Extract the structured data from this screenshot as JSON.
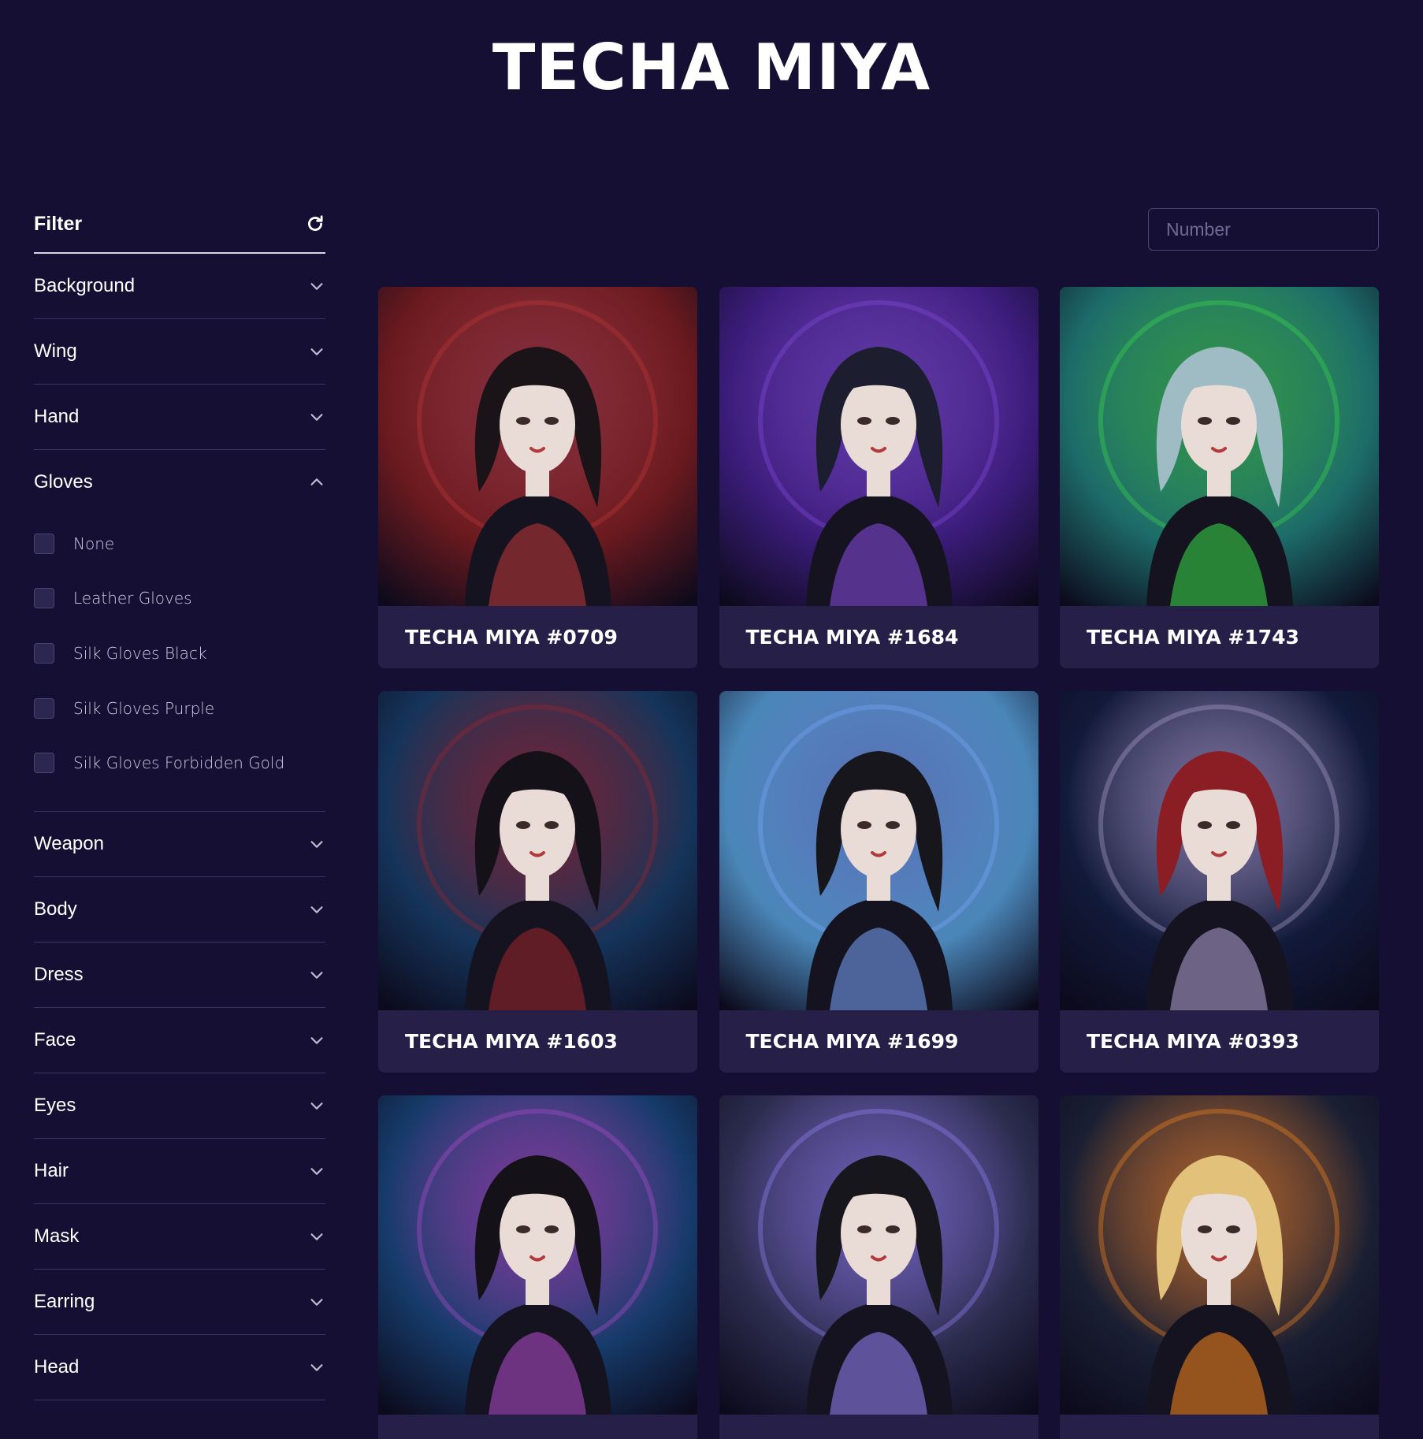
{
  "title": "TECHA MIYA",
  "filter": {
    "title": "Filter",
    "sections": [
      {
        "label": "Background",
        "expanded": false
      },
      {
        "label": "Wing",
        "expanded": false
      },
      {
        "label": "Hand",
        "expanded": false
      },
      {
        "label": "Gloves",
        "expanded": true,
        "options": [
          "None",
          "Leather Gloves",
          "Silk Gloves Black",
          "Silk Gloves Purple",
          "Silk Gloves Forbidden Gold"
        ]
      },
      {
        "label": "Weapon",
        "expanded": false
      },
      {
        "label": "Body",
        "expanded": false
      },
      {
        "label": "Dress",
        "expanded": false
      },
      {
        "label": "Face",
        "expanded": false
      },
      {
        "label": "Eyes",
        "expanded": false
      },
      {
        "label": "Hair",
        "expanded": false
      },
      {
        "label": "Mask",
        "expanded": false
      },
      {
        "label": "Earring",
        "expanded": false
      },
      {
        "label": "Head",
        "expanded": false
      }
    ]
  },
  "search": {
    "placeholder": "Number",
    "value": ""
  },
  "cards": [
    {
      "name": "TECHA MIYA #0709",
      "bg": "#6b1a1e",
      "accent": "#c23a3a",
      "hair": "#1a1418"
    },
    {
      "name": "TECHA MIYA #1684",
      "bg": "#3b1c7a",
      "accent": "#8a4ce6",
      "hair": "#1c1d2e"
    },
    {
      "name": "TECHA MIYA #1743",
      "bg": "#1d6b6a",
      "accent": "#3be04b",
      "hair": "#9fbcc4"
    },
    {
      "name": "TECHA MIYA #1603",
      "bg": "#15345a",
      "accent": "#a1262c",
      "hair": "#141218"
    },
    {
      "name": "TECHA MIYA #1699",
      "bg": "#4a86b8",
      "accent": "#7aa8ff",
      "hair": "#16161c"
    },
    {
      "name": "TECHA MIYA #0393",
      "bg": "#121a3a",
      "accent": "#b6a8d8",
      "hair": "#8a1e24"
    },
    {
      "name": "",
      "bg": "#163b6a",
      "accent": "#b64cd0",
      "hair": "#141218"
    },
    {
      "name": "",
      "bg": "#2c2c4e",
      "accent": "#9a86ff",
      "hair": "#16161c"
    },
    {
      "name": "",
      "bg": "#1a1f33",
      "accent": "#ff8a1c",
      "hair": "#e2c27a"
    }
  ]
}
